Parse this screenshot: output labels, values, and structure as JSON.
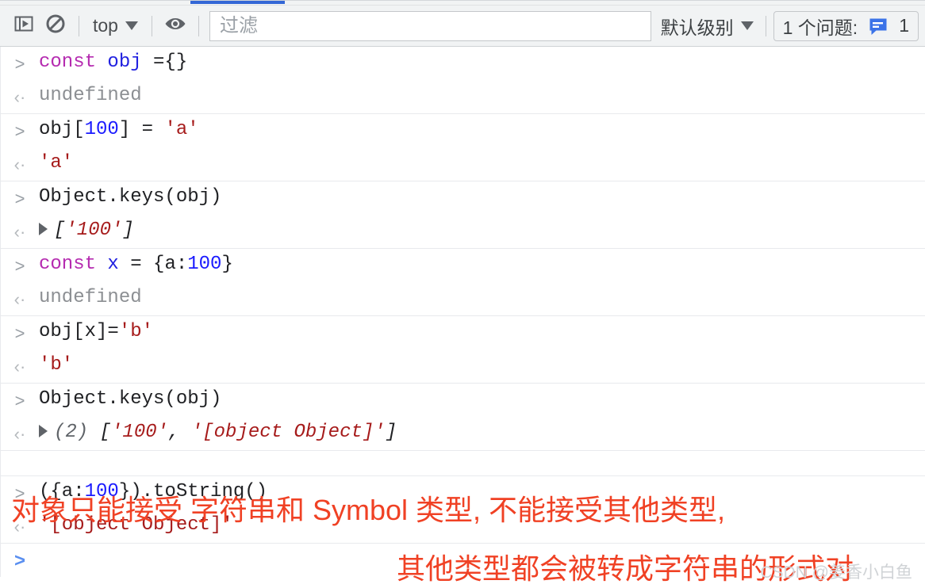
{
  "toolbar": {
    "drawer_toggle_name": "show-console-sidebar-icon",
    "clear_name": "clear-console-icon",
    "context_value": "top",
    "eye_name": "create-live-expression-icon",
    "filter_placeholder": "过滤",
    "filter_value": "",
    "level_value": "默认级别",
    "issues_label": "1 个问题:",
    "issues_count": "1",
    "accent_color": "#3367d6",
    "issue_icon_color": "#3b73e8"
  },
  "console": {
    "rows": [
      {
        "kind": "input",
        "marker": ">",
        "tokens": [
          {
            "text": "const ",
            "cls": "t-kw"
          },
          {
            "text": "obj ",
            "cls": "t-var"
          },
          {
            "text": "={}",
            "cls": "t-plain"
          }
        ]
      },
      {
        "kind": "output",
        "marker": "‹·",
        "tokens": [
          {
            "text": "undefined",
            "cls": "t-undef"
          }
        ]
      },
      {
        "kind": "input",
        "marker": ">",
        "separator": true,
        "tokens": [
          {
            "text": "obj[",
            "cls": "t-plain"
          },
          {
            "text": "100",
            "cls": "t-num"
          },
          {
            "text": "] = ",
            "cls": "t-plain"
          },
          {
            "text": "'a'",
            "cls": "t-str"
          }
        ]
      },
      {
        "kind": "output",
        "marker": "‹·",
        "tokens": [
          {
            "text": "'a'",
            "cls": "t-str"
          }
        ]
      },
      {
        "kind": "input",
        "marker": ">",
        "separator": true,
        "tokens": [
          {
            "text": "Object.keys(obj)",
            "cls": "t-plain"
          }
        ]
      },
      {
        "kind": "output",
        "marker": "‹·",
        "expandable": true,
        "tokens": [
          {
            "text": "[",
            "cls": "t-brkt"
          },
          {
            "text": "'100'",
            "cls": "t-str t-italic"
          },
          {
            "text": "]",
            "cls": "t-brkt"
          }
        ]
      },
      {
        "kind": "input",
        "marker": ">",
        "separator": true,
        "tokens": [
          {
            "text": "const ",
            "cls": "t-kw"
          },
          {
            "text": "x ",
            "cls": "t-var"
          },
          {
            "text": "= {a:",
            "cls": "t-plain"
          },
          {
            "text": "100",
            "cls": "t-num"
          },
          {
            "text": "}",
            "cls": "t-plain"
          }
        ]
      },
      {
        "kind": "output",
        "marker": "‹·",
        "tokens": [
          {
            "text": "undefined",
            "cls": "t-undef"
          }
        ]
      },
      {
        "kind": "input",
        "marker": ">",
        "separator": true,
        "tokens": [
          {
            "text": "obj[x]=",
            "cls": "t-plain"
          },
          {
            "text": "'b'",
            "cls": "t-str"
          }
        ]
      },
      {
        "kind": "output",
        "marker": "‹·",
        "tokens": [
          {
            "text": "'b'",
            "cls": "t-str"
          }
        ]
      },
      {
        "kind": "input",
        "marker": ">",
        "separator": true,
        "tokens": [
          {
            "text": "Object.keys(obj)",
            "cls": "t-plain"
          }
        ]
      },
      {
        "kind": "output",
        "marker": "‹·",
        "expandable": true,
        "tokens": [
          {
            "text": "(2) ",
            "cls": "t-count"
          },
          {
            "text": "[",
            "cls": "t-brkt"
          },
          {
            "text": "'100'",
            "cls": "t-str t-italic"
          },
          {
            "text": ", ",
            "cls": "t-brkt"
          },
          {
            "text": "'[object Object]'",
            "cls": "t-str t-italic"
          },
          {
            "text": "]",
            "cls": "t-brkt"
          }
        ]
      },
      {
        "kind": "spacer",
        "marker": "",
        "separator": true,
        "tokens": []
      },
      {
        "kind": "input",
        "marker": ">",
        "separator": true,
        "tokens": [
          {
            "text": "({a:",
            "cls": "t-plain"
          },
          {
            "text": "100",
            "cls": "t-num"
          },
          {
            "text": "}).toString()",
            "cls": "t-plain"
          }
        ]
      },
      {
        "kind": "output",
        "marker": "‹·",
        "tokens": [
          {
            "text": "'[object Object]'",
            "cls": "t-str"
          }
        ]
      },
      {
        "kind": "prompt",
        "marker": ">",
        "separator": true,
        "tokens": []
      }
    ]
  },
  "annotations": [
    {
      "id": "annot-1",
      "text": "对象只能接受 字符串和 Symbol 类型, 不能接受其他类型,",
      "color": "#f04124"
    },
    {
      "id": "annot-2",
      "text": "其他类型都会被转成字符串的形式对",
      "color": "#f04124"
    }
  ],
  "watermark": {
    "text": "CSDN @姜香小白鱼"
  }
}
